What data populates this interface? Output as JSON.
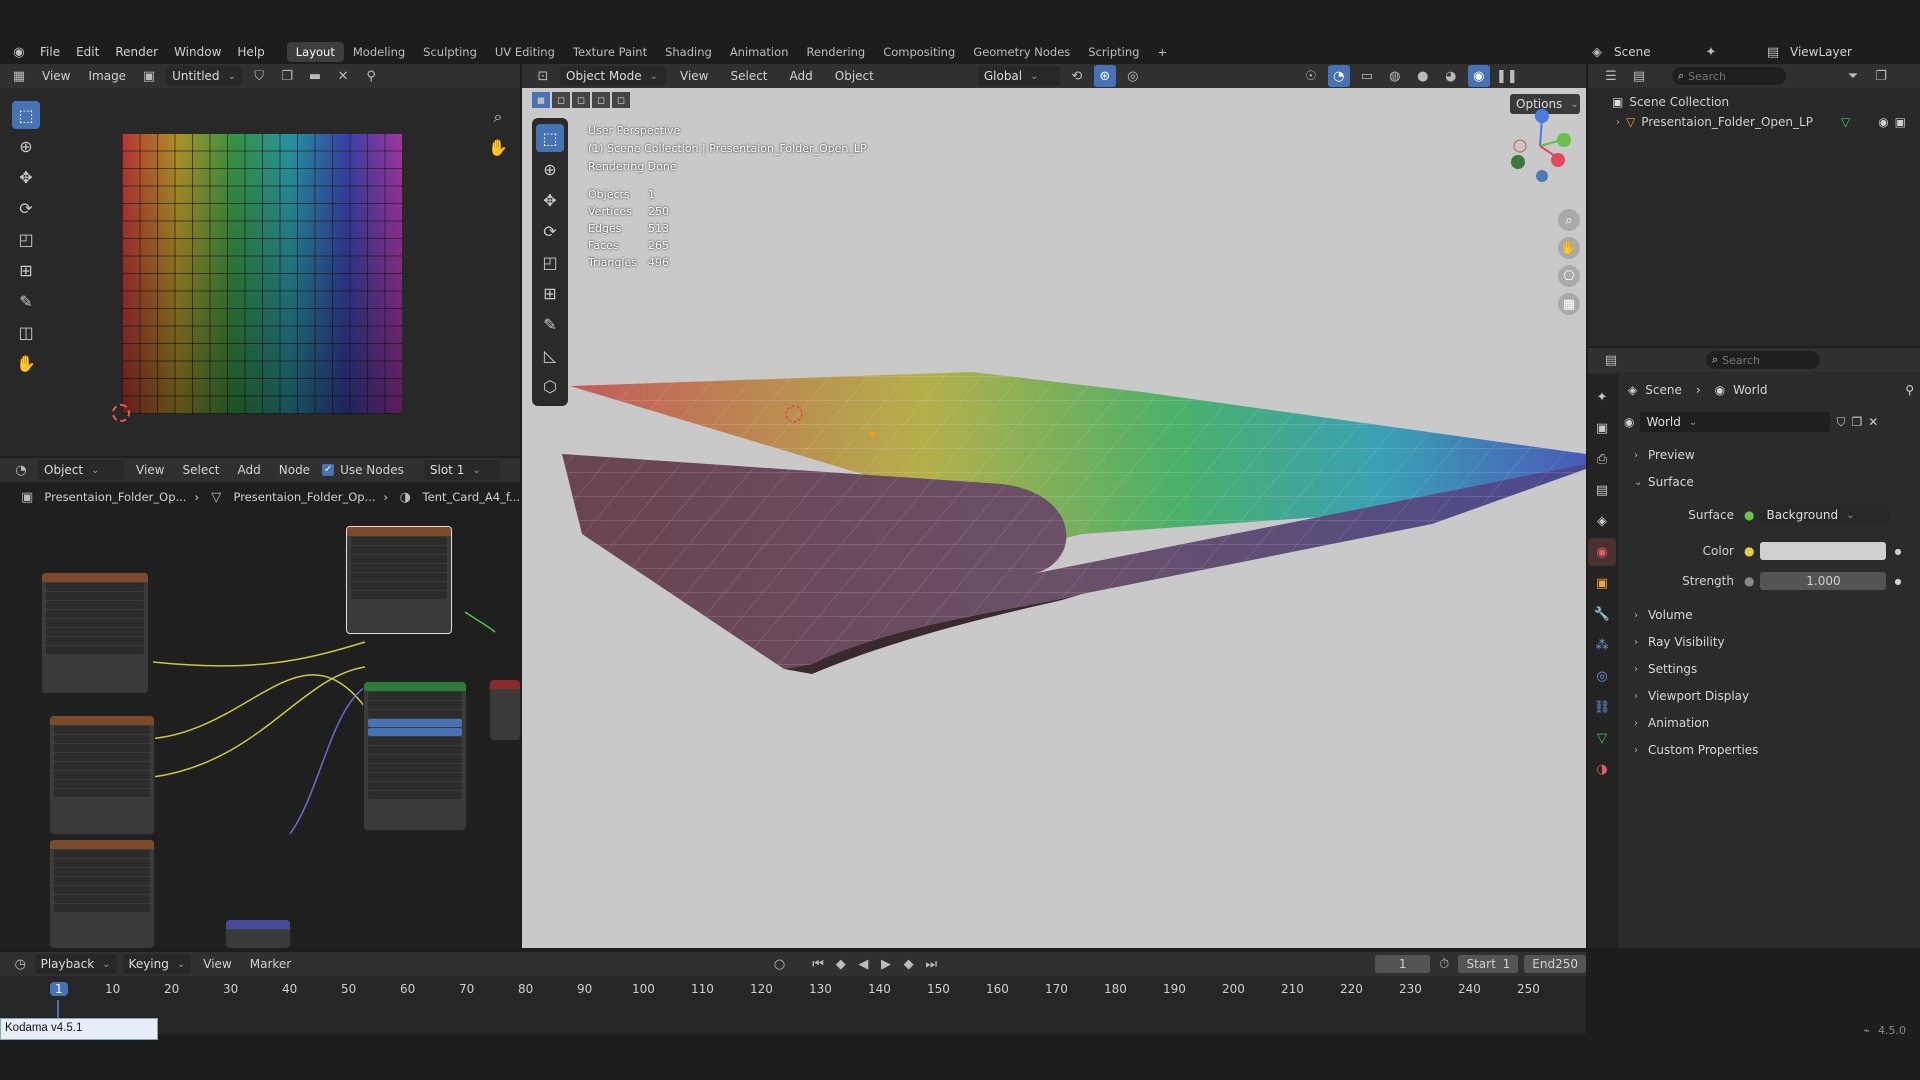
{
  "topbar": {
    "menus": [
      "File",
      "Edit",
      "Render",
      "Window",
      "Help"
    ],
    "workspaces": [
      "Layout",
      "Modeling",
      "Sculpting",
      "UV Editing",
      "Texture Paint",
      "Shading",
      "Animation",
      "Rendering",
      "Compositing",
      "Geometry Nodes",
      "Scripting"
    ],
    "active_workspace": "Layout",
    "add_tab": "+",
    "scene": "Scene",
    "view_layer": "ViewLayer"
  },
  "image_editor": {
    "menus": [
      "View",
      "Image"
    ],
    "image_name": "Untitled"
  },
  "viewport": {
    "mode": "Object Mode",
    "menus": [
      "View",
      "Select",
      "Add",
      "Object"
    ],
    "orientation": "Global",
    "options": "Options",
    "overlay_lines": [
      "User Perspective",
      "(1) Scene Collection | Presentaion_Folder_Open_LP",
      "Rendering Done"
    ],
    "stats": [
      {
        "label": "Objects",
        "value": "1"
      },
      {
        "label": "Vertices",
        "value": "250"
      },
      {
        "label": "Edges",
        "value": "513"
      },
      {
        "label": "Faces",
        "value": "265"
      },
      {
        "label": "Triangles",
        "value": "496"
      }
    ]
  },
  "node_editor": {
    "type": "Object",
    "menus": [
      "View",
      "Select",
      "Add",
      "Node"
    ],
    "use_nodes": "Use Nodes",
    "slot": "Slot 1",
    "breadcrumb": [
      "Presentaion_Folder_Op...",
      "Presentaion_Folder_Op...",
      "Tent_Card_A4_f..."
    ]
  },
  "outliner": {
    "search_placeholder": "Search",
    "collection": "Scene Collection",
    "object": "Presentaion_Folder_Open_LP"
  },
  "properties": {
    "search_placeholder": "Search",
    "breadcrumb": [
      "Scene",
      "World"
    ],
    "world_name": "World",
    "sections": [
      "Preview",
      "Surface",
      "Volume",
      "Ray Visibility",
      "Settings",
      "Viewport Display",
      "Animation",
      "Custom Properties"
    ],
    "surface_label": "Surface",
    "surface_value": "Background",
    "color_label": "Color",
    "strength_label": "Strength",
    "strength_value": "1.000"
  },
  "timeline": {
    "menus": [
      "Playback",
      "Keying",
      "View",
      "Marker"
    ],
    "current_frame": "1",
    "start_label": "Start",
    "start_value": "1",
    "end_label": "End",
    "end_value": "250",
    "ticks": [
      "1",
      "10",
      "20",
      "30",
      "40",
      "50",
      "60",
      "70",
      "80",
      "90",
      "100",
      "110",
      "120",
      "130",
      "140",
      "150",
      "160",
      "170",
      "180",
      "190",
      "200",
      "210",
      "220",
      "230",
      "240",
      "250"
    ]
  },
  "statusbar": {
    "tooltip": "Kodama v4.5.1",
    "version": "4.5.0"
  },
  "colors": {
    "accent": "#4772b3",
    "bg": "#1d1d1d",
    "panel": "#303030",
    "viewport": "#c9c9c9"
  }
}
